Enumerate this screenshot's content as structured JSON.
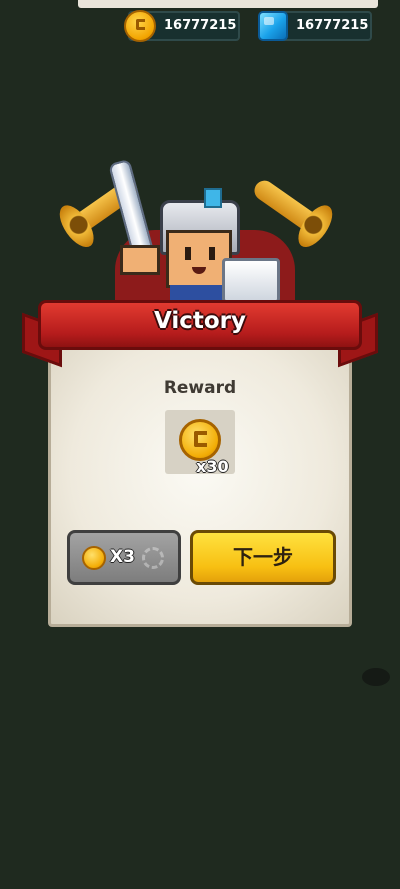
{
  "currencies": {
    "coins": {
      "value": "16777215",
      "icon": "coin-icon"
    },
    "gems": {
      "value": "16777215",
      "icon": "gem-icon"
    }
  },
  "dialog": {
    "title": "Victory",
    "reward_label": "Reward",
    "reward": {
      "icon": "coin-icon",
      "quantity": "x30"
    },
    "multiplier_button": {
      "label": "X3",
      "icon": "coin-icon"
    },
    "next_button": {
      "label": "下一步"
    }
  },
  "colors": {
    "background": "#1f2a1f",
    "ribbon": "#c62222",
    "next_button": "#f7bf12",
    "multiplier_button": "#8a8a8a"
  }
}
